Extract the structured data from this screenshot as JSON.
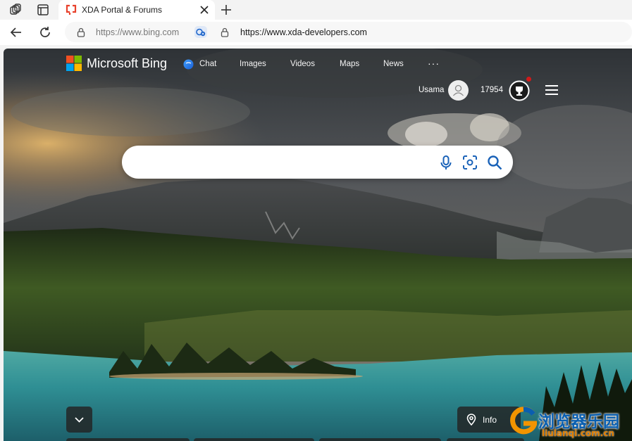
{
  "browser": {
    "tab": {
      "title": "XDA Portal & Forums"
    },
    "address_bar": {
      "previous_url": "https://www.bing.com",
      "url": "https://www.xda-developers.com"
    }
  },
  "bing": {
    "logo_text": "Microsoft Bing",
    "nav": [
      "Chat",
      "Images",
      "Videos",
      "Maps",
      "News"
    ],
    "more_symbol": "···",
    "user": {
      "name": "Usama",
      "points": "17954"
    },
    "search": {
      "value": "",
      "placeholder": ""
    },
    "info_button": "Info"
  },
  "watermark": {
    "text": "浏览器乐园",
    "domain": "liulanqi.com.cn"
  },
  "colors": {
    "accent_blue": "#0067b8",
    "reward_dot": "#d21a1a",
    "watermark_blue": "#0a5fb0",
    "watermark_orange": "#f29400"
  }
}
